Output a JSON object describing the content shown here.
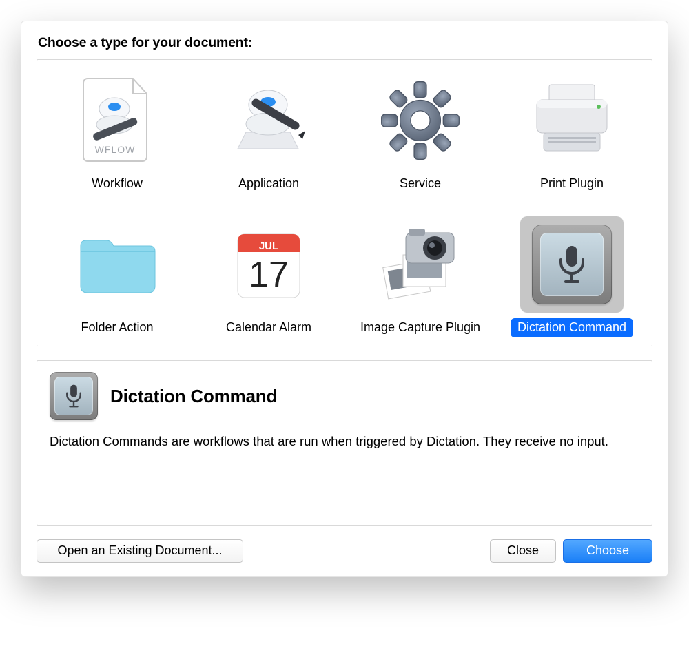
{
  "heading": "Choose a type for your document:",
  "types": [
    {
      "id": "workflow",
      "label": "Workflow",
      "selected": false
    },
    {
      "id": "application",
      "label": "Application",
      "selected": false
    },
    {
      "id": "service",
      "label": "Service",
      "selected": false
    },
    {
      "id": "print-plugin",
      "label": "Print Plugin",
      "selected": false
    },
    {
      "id": "folder-action",
      "label": "Folder Action",
      "selected": false
    },
    {
      "id": "calendar-alarm",
      "label": "Calendar Alarm",
      "selected": false
    },
    {
      "id": "image-capture",
      "label": "Image Capture Plugin",
      "selected": false
    },
    {
      "id": "dictation",
      "label": "Dictation Command",
      "selected": true
    }
  ],
  "detail": {
    "title": "Dictation Command",
    "description": "Dictation Commands are workflows that are run when triggered by Dictation. They receive no input."
  },
  "buttons": {
    "open": "Open an Existing Document...",
    "close": "Close",
    "choose": "Choose"
  },
  "calendar": {
    "month": "JUL",
    "day": "17"
  },
  "workflow_badge": "WFLOW"
}
